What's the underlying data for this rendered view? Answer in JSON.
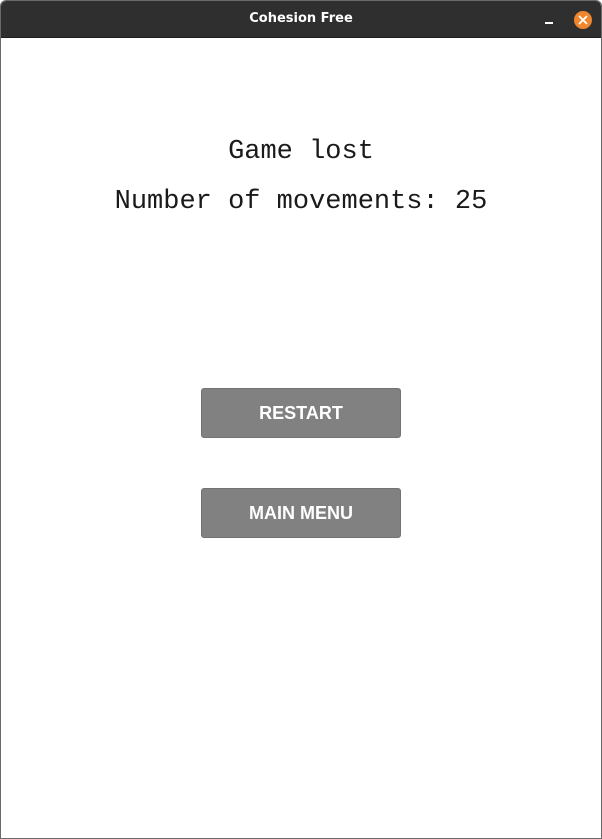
{
  "window": {
    "title": "Cohesion Free"
  },
  "game_over": {
    "status": "Game lost",
    "movements_label": "Number of movements:",
    "movements_count": "25"
  },
  "buttons": {
    "restart_label": "RESTART",
    "main_menu_label": "MAIN MENU"
  },
  "icons": {
    "minimize": "minimize-icon",
    "close": "close-icon"
  },
  "colors": {
    "titlebar": "#2f2f2f",
    "close_button": "#f0862e",
    "button_background": "#818181",
    "button_text": "#ffffff",
    "background": "#ffffff"
  }
}
